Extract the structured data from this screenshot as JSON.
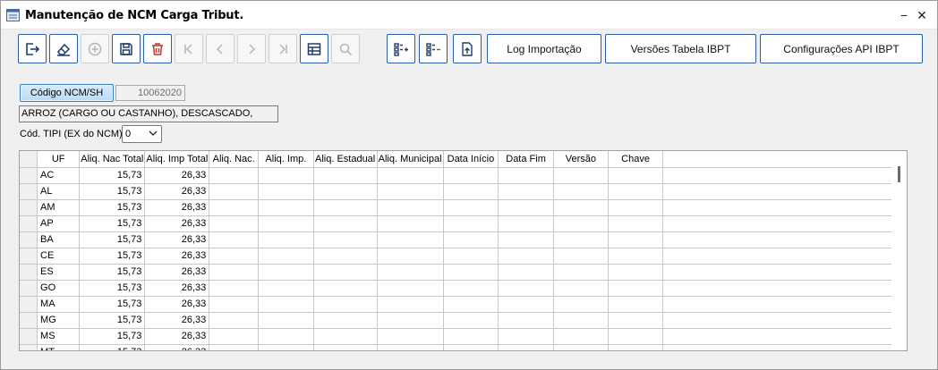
{
  "window": {
    "title": "Manutenção de NCM Carga Tribut.",
    "minimize": "−",
    "close": "✕"
  },
  "toolbar": {
    "icons": [
      "exit-icon",
      "eraser-icon",
      "add-circle-icon",
      "save-icon",
      "delete-icon",
      "first-record-icon",
      "previous-record-icon",
      "next-record-icon",
      "last-record-icon",
      "grid-view-icon",
      "search-icon",
      "list-add-icon",
      "list-remove-icon",
      "upload-file-icon"
    ],
    "log_label": "Log Importação",
    "versions_label": "Versões Tabela IBPT",
    "config_label": "Configurações API IBPT",
    "accent": "#2c5ea8",
    "delete_color": "#c0392b"
  },
  "form": {
    "ncm_button": "Código NCM/SH",
    "ncm_code": "10062020",
    "description": "ARROZ (CARGO OU CASTANHO), DESCASCADO,",
    "tipi_label": "Cód. TIPI (EX do NCM)",
    "tipi_value": "0"
  },
  "grid": {
    "columns": [
      "UF",
      "Aliq. Nac Total",
      "Aliq. Imp Total",
      "Aliq. Nac.",
      "Aliq. Imp.",
      "Aliq. Estadual",
      "Aliq. Municipal",
      "Data Início",
      "Data Fim",
      "Versão",
      "Chave"
    ],
    "rows": [
      [
        "AC",
        "15,73",
        "26,33"
      ],
      [
        "AL",
        "15,73",
        "26,33"
      ],
      [
        "AM",
        "15,73",
        "26,33"
      ],
      [
        "AP",
        "15,73",
        "26,33"
      ],
      [
        "BA",
        "15,73",
        "26,33"
      ],
      [
        "CE",
        "15,73",
        "26,33"
      ],
      [
        "ES",
        "15,73",
        "26,33"
      ],
      [
        "GO",
        "15,73",
        "26,33"
      ],
      [
        "MA",
        "15,73",
        "26,33"
      ],
      [
        "MG",
        "15,73",
        "26,33"
      ],
      [
        "MS",
        "15,73",
        "26,33"
      ],
      [
        "MT",
        "15,73",
        "26,33"
      ]
    ]
  }
}
